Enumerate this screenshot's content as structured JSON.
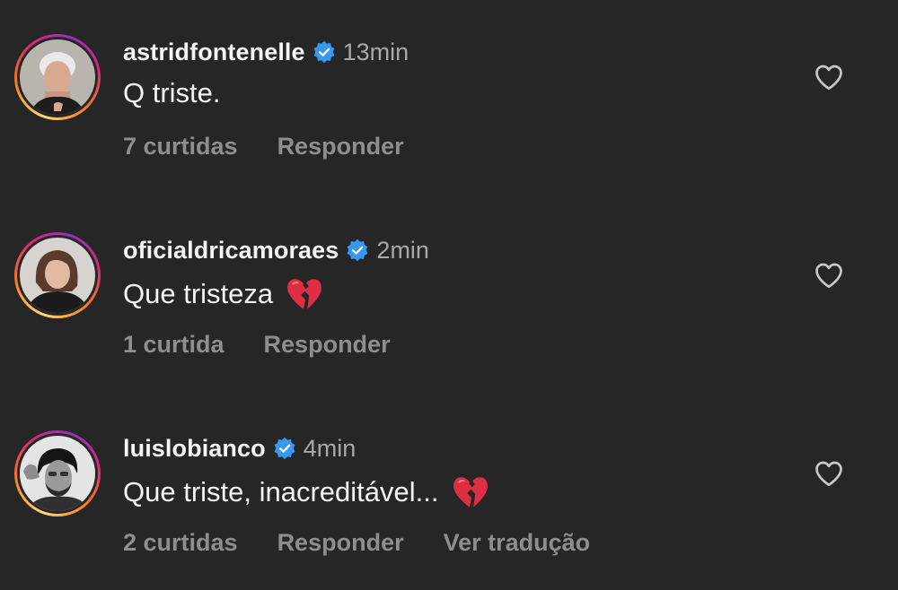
{
  "comments": [
    {
      "username": "astridfontenelle",
      "time": "13min",
      "text": "Q triste.",
      "likes": "7 curtidas",
      "reply": "Responder"
    },
    {
      "username": "oficialdricamoraes",
      "time": "2min",
      "text": "Que tristeza",
      "likes": "1 curtida",
      "reply": "Responder",
      "emoji": "broken-heart"
    },
    {
      "username": "luislobianco",
      "time": "4min",
      "text": "Que triste, inacreditável...",
      "likes": "2 curtidas",
      "reply": "Responder",
      "translate": "Ver tradução",
      "emoji": "broken-heart"
    }
  ],
  "colors": {
    "background": "#262626",
    "text_primary": "#f5f5f5",
    "text_secondary": "#8e8e8e",
    "verified_blue": "#3897f0"
  }
}
